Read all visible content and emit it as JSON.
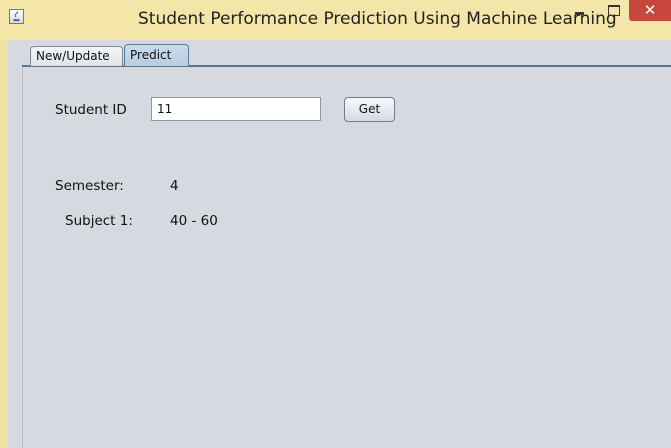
{
  "window": {
    "title": "Student Performance Prediction Using Machine Learning",
    "close_symbol": "✕"
  },
  "tabs": [
    {
      "label": "New/Update",
      "selected": false
    },
    {
      "label": "Predict",
      "selected": true
    }
  ],
  "form": {
    "student_id_label": "Student ID",
    "student_id_value": "11",
    "get_button_label": "Get"
  },
  "result": {
    "semester_label": "Semester:",
    "semester_value": "4",
    "subject_label": "Subject 1:",
    "subject_value": "40 - 60"
  },
  "colors": {
    "title_bar": "#f4e6a8",
    "close_button": "#c7463d",
    "content_background": "#d6d9df",
    "selected_tab": "#c0d5e7"
  },
  "icons": [
    "java-app-icon",
    "minimize-icon",
    "maximize-icon",
    "close-icon"
  ]
}
